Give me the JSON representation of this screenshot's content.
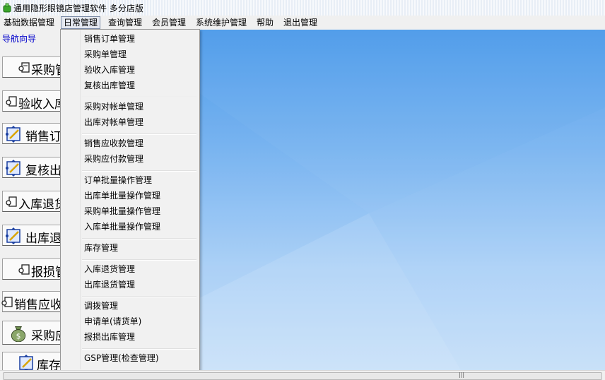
{
  "window": {
    "title": "通用隐形眼镜店管理软件    多分店版"
  },
  "menubar": {
    "items": [
      {
        "label": "基础数据管理"
      },
      {
        "label": "日常管理"
      },
      {
        "label": "查询管理"
      },
      {
        "label": "会员管理"
      },
      {
        "label": "系统维护管理"
      },
      {
        "label": "帮助"
      },
      {
        "label": "退出管理"
      }
    ],
    "active_index": 1
  },
  "nav": {
    "header": "导航向导",
    "buttons": [
      {
        "label": "采购管",
        "icon": "document-icon"
      },
      {
        "label": "验收入库",
        "icon": "document-icon"
      },
      {
        "label": "销售订",
        "icon": "edit-blue-icon"
      },
      {
        "label": "复核出",
        "icon": "edit-blue-icon"
      },
      {
        "label": "入库退货",
        "icon": "document-icon"
      },
      {
        "label": "出库退",
        "icon": "edit-blue-icon"
      },
      {
        "label": "报损管",
        "icon": "document-icon"
      },
      {
        "label": "销售应收",
        "icon": "document-icon"
      },
      {
        "label": "采购应",
        "icon": "money-bag-icon"
      },
      {
        "label": "库存",
        "icon": "edit-blue-icon"
      }
    ]
  },
  "dropdown": {
    "groups": [
      [
        "销售订单管理",
        "采购单管理",
        "验收入库管理",
        "复核出库管理"
      ],
      [
        "采购对帐单管理",
        "出库对帐单管理"
      ],
      [
        "销售应收款管理",
        "采购应付款管理"
      ],
      [
        "订单批量操作管理",
        "出库单批量操作管理",
        "采购单批量操作管理",
        "入库单批量操作管理"
      ],
      [
        "库存管理"
      ],
      [
        "入库退货管理",
        "出库退货管理"
      ],
      [
        "调拨管理",
        "申请单(请货单)",
        "报损出库管理"
      ],
      [
        "GSP管理(检查管理)"
      ]
    ]
  },
  "scrollbar": {
    "grip": "|||"
  },
  "colors": {
    "link_blue": "#0000cc",
    "desktop_top": "#3f93e8",
    "desktop_bottom": "#c2ddf8"
  }
}
